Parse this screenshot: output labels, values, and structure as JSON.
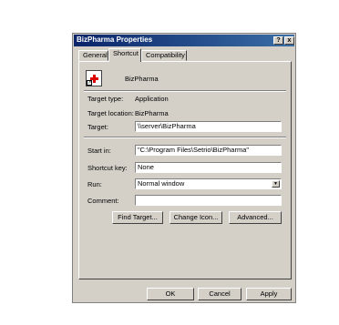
{
  "window": {
    "title": "BizPharma Properties",
    "help_glyph": "?",
    "close_glyph": "x"
  },
  "tabs": [
    {
      "label": "General"
    },
    {
      "label": "Shortcut"
    },
    {
      "label": "Compatibility"
    }
  ],
  "shortcut": {
    "app_name": "BizPharma",
    "target_type_label": "Target type:",
    "target_type_value": "Application",
    "target_location_label": "Target location:",
    "target_location_value": "BizPharma",
    "target_label": "Target:",
    "target_value": "\\\\server\\BizPharma",
    "start_in_label": "Start in:",
    "start_in_value": "\"C:\\Program Files\\Setrio\\BizPharma\"",
    "shortcut_key_label": "Shortcut key:",
    "shortcut_key_value": "None",
    "run_label": "Run:",
    "run_value": "Normal window",
    "comment_label": "Comment:",
    "comment_value": "",
    "find_target_label": "Find Target...",
    "change_icon_label": "Change Icon...",
    "advanced_label": "Advanced..."
  },
  "footer": {
    "ok_label": "OK",
    "cancel_label": "Cancel",
    "apply_label": "Apply"
  },
  "colors": {
    "titlebar_start": "#0a246a",
    "titlebar_end": "#3a6ea5",
    "dialog_bg": "#d4d0c8",
    "icon_cross": "#dd0000"
  }
}
